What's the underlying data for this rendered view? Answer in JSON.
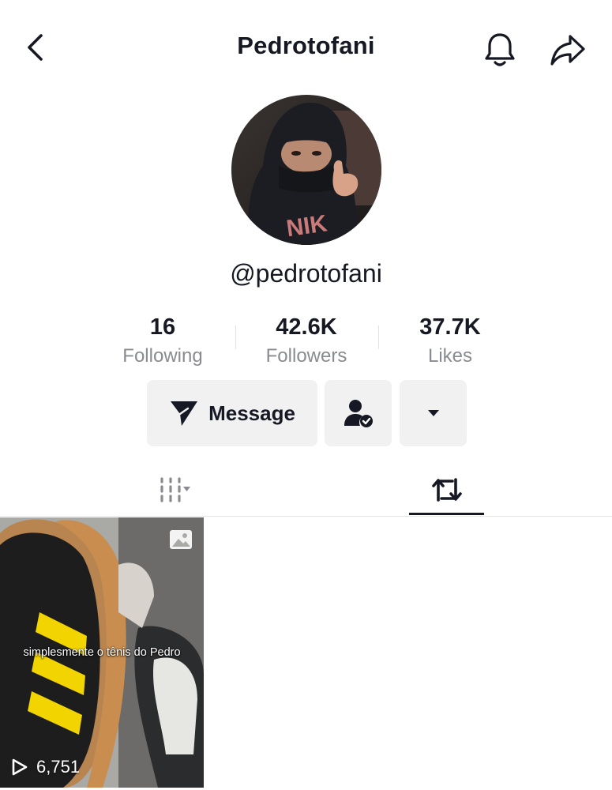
{
  "header": {
    "title": "Pedrotofani"
  },
  "profile": {
    "handle": "@pedrotofani",
    "stats": [
      {
        "value": "16",
        "label": "Following"
      },
      {
        "value": "42.6K",
        "label": "Followers"
      },
      {
        "value": "37.7K",
        "label": "Likes"
      }
    ]
  },
  "actions": {
    "message_label": "Message"
  },
  "videos": [
    {
      "caption": "simplesmente o tênis do Pedro",
      "views": "6,751"
    }
  ],
  "colors": {
    "text": "#161823",
    "secondary_text": "#8a8b91",
    "button_bg": "#f1f1f2"
  },
  "icons": {
    "back": "chevron-left-icon",
    "notifications": "bell-icon",
    "share": "share-arrow-icon",
    "message": "paper-plane-icon",
    "friend": "person-check-icon",
    "more": "caret-down-icon",
    "videos_tab": "grid-icon",
    "reposts_tab": "repost-icon",
    "views": "play-icon",
    "photo": "photo-icon"
  }
}
